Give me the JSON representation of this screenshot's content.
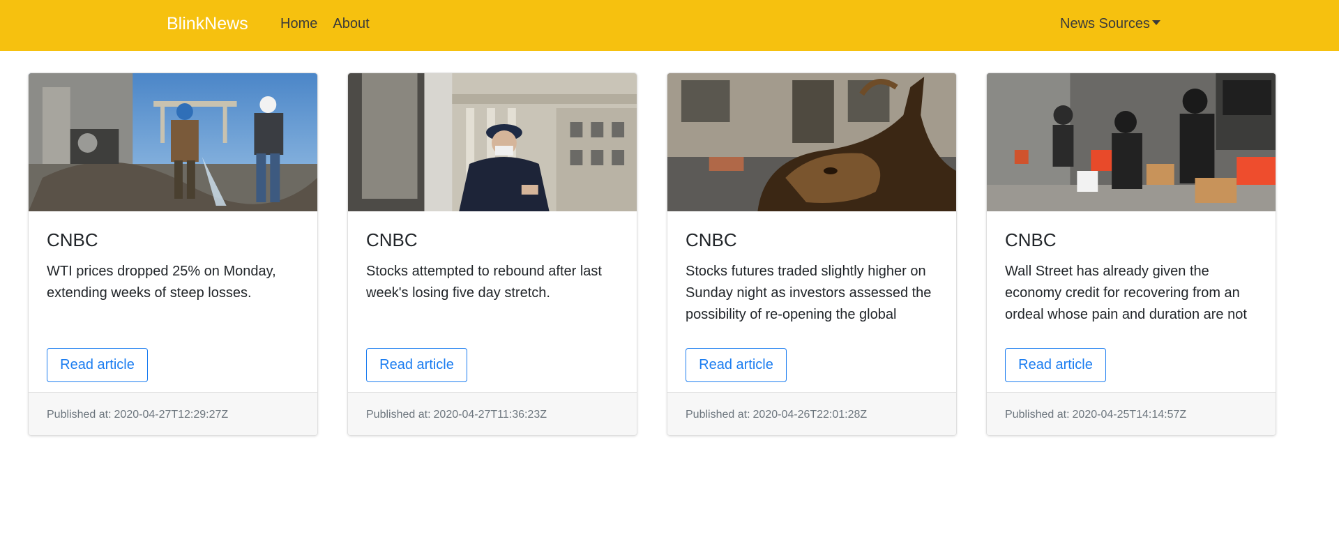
{
  "navbar": {
    "brand": "BlinkNews",
    "links": [
      "Home",
      "About"
    ],
    "dropdown_label": "News Sources",
    "background_color": "#f6c10f"
  },
  "cards": [
    {
      "source": "CNBC",
      "description": "WTI prices dropped 25% on Monday, extending weeks of steep losses.",
      "button_label": "Read article",
      "published_label": "Published at:",
      "published_at": "2020-04-27T12:29:27Z",
      "image": "oil-workers-photo"
    },
    {
      "source": "CNBC",
      "description": "Stocks attempted to rebound after last week's losing five day stretch.",
      "button_label": "Read article",
      "published_label": "Published at:",
      "published_at": "2020-04-27T11:36:23Z",
      "image": "nyse-trader-mask-photo"
    },
    {
      "source": "CNBC",
      "description": "Stocks futures traded slightly higher on Sunday night as investors assessed the possibility of re-opening the global",
      "button_label": "Read article",
      "published_label": "Published at:",
      "published_at": "2020-04-26T22:01:28Z",
      "image": "wall-street-bull-photo"
    },
    {
      "source": "CNBC",
      "description": "Wall Street has already given the economy credit for recovering from an ordeal whose pain and duration are not",
      "button_label": "Read article",
      "published_label": "Published at:",
      "published_at": "2020-04-25T14:14:57Z",
      "image": "food-distribution-brooklyn-photo"
    }
  ]
}
